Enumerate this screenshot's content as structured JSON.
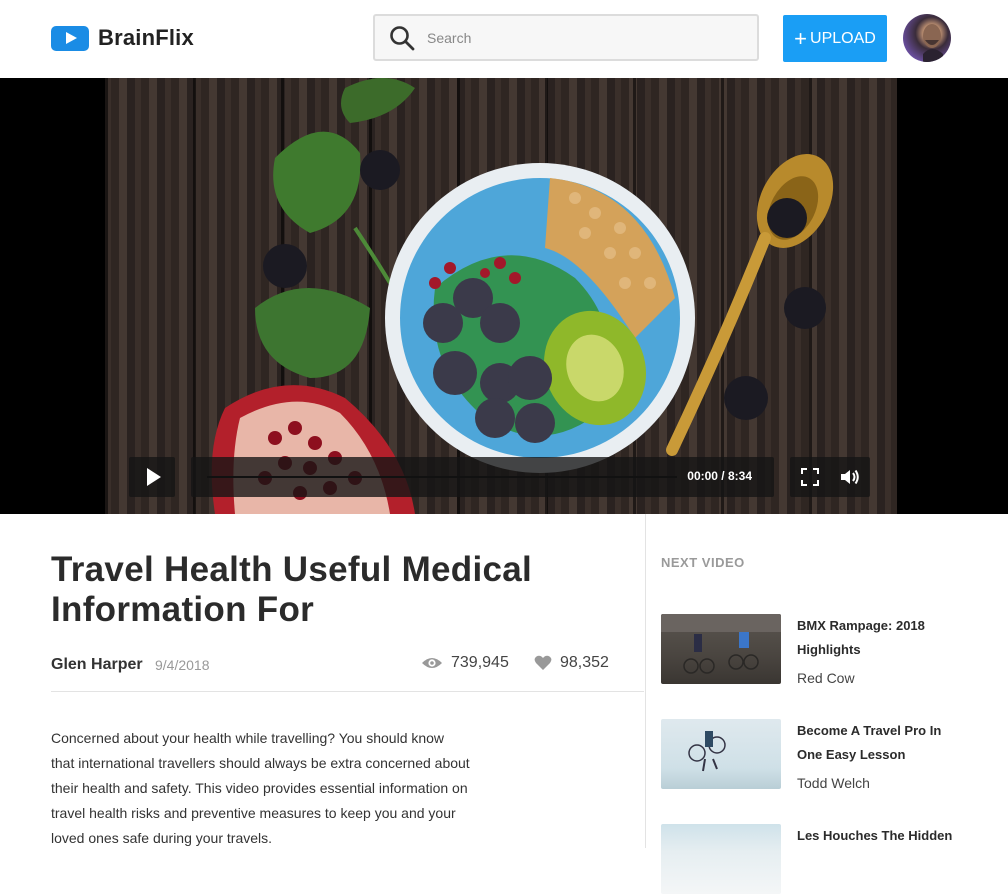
{
  "header": {
    "brand": "BrainFlix",
    "search_placeholder": "Search",
    "upload_label": "UPLOAD",
    "icons": {
      "logo": "play-icon",
      "search": "search-icon",
      "upload": "plus-icon"
    }
  },
  "player": {
    "time": "00:00 / 8:34",
    "progress_fraction": 0,
    "icons": {
      "play": "play-icon",
      "fullscreen": "fullscreen-icon",
      "volume": "volume-icon"
    }
  },
  "video": {
    "title": "Travel Health Useful Medical Information For",
    "author": "Glen Harper",
    "date": "9/4/2018",
    "views": "739,945",
    "likes": "98,352",
    "description": "Concerned about your health while travelling? You should know that international travellers should always be extra concerned about their health and safety. This video provides essential information on travel health risks and preventive measures to keep you and your loved ones safe during your travels."
  },
  "sidebar": {
    "heading": "NEXT VIDEO",
    "items": [
      {
        "title": "BMX Rampage: 2018 Highlights",
        "channel": "Red Cow"
      },
      {
        "title": "Become A Travel Pro In One Easy Lesson",
        "channel": "Todd Welch"
      },
      {
        "title": "Les Houches The Hidden",
        "channel": ""
      }
    ]
  },
  "colors": {
    "accent": "#1a9ef5",
    "logo": "#1a8ce5"
  }
}
